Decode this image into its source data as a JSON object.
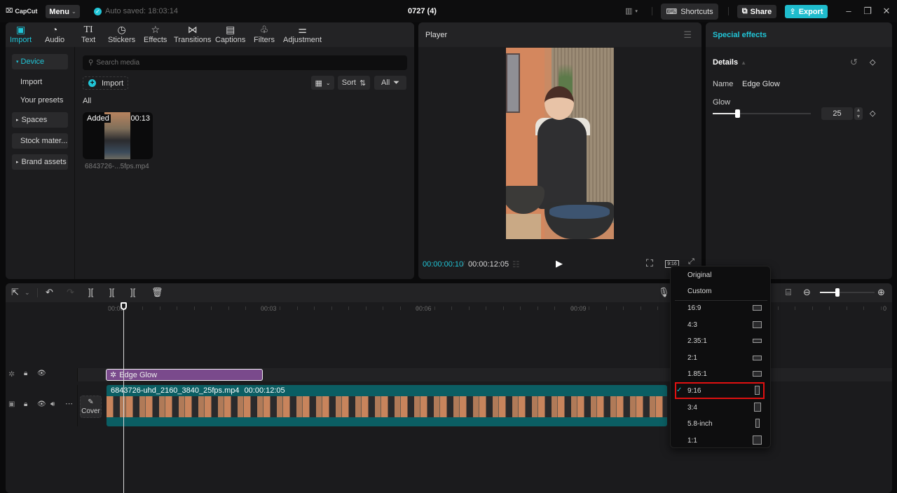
{
  "titlebar": {
    "app_name": "CapCut",
    "menu_label": "Menu",
    "autosave_text": "Auto saved: 18:03:14",
    "project_title": "0727 (4)",
    "shortcuts_label": "Shortcuts",
    "share_label": "Share",
    "export_label": "Export",
    "accent_color": "#21c5d7"
  },
  "media_tabs": [
    {
      "label": "Import",
      "icon": "import-icon",
      "active": true
    },
    {
      "label": "Audio",
      "icon": "audio-icon"
    },
    {
      "label": "Text",
      "icon": "text-icon"
    },
    {
      "label": "Stickers",
      "icon": "stickers-icon"
    },
    {
      "label": "Effects",
      "icon": "effects-icon"
    },
    {
      "label": "Transitions",
      "icon": "transitions-icon"
    },
    {
      "label": "Captions",
      "icon": "captions-icon"
    },
    {
      "label": "Filters",
      "icon": "filters-icon"
    },
    {
      "label": "Adjustment",
      "icon": "adjustment-icon"
    }
  ],
  "media_sidebar": {
    "items": [
      {
        "label": "Device",
        "expanded": true,
        "active": true
      },
      {
        "label": "Import"
      },
      {
        "label": "Your presets"
      },
      {
        "label": "Spaces",
        "collapsed": true
      },
      {
        "label": "Stock mater..."
      },
      {
        "label": "Brand assets",
        "collapsed": true
      }
    ]
  },
  "media": {
    "search_placeholder": "Search media",
    "import_label": "Import",
    "sort_label": "Sort",
    "filter_label": "All",
    "section_label": "All",
    "items": [
      {
        "badge": "Added",
        "duration": "00:13",
        "filename": "6843726-...5fps.mp4"
      }
    ]
  },
  "player": {
    "title": "Player",
    "current_time": "00:00:00:10",
    "total_time": "00:00:12:05",
    "ratio_label": "9:16"
  },
  "properties": {
    "header": "Special effects",
    "section": "Details",
    "name_label": "Name",
    "name_value": "Edge Glow",
    "glow_label": "Glow",
    "glow_value": "25",
    "glow_fraction": 0.25
  },
  "timeline": {
    "ruler_labels": [
      "00:00",
      "00:03",
      "00:06",
      "00:09",
      "0"
    ],
    "effect_clip_label": "Edge Glow",
    "video_clip_name": "6843726-uhd_2160_3840_25fps.mp4",
    "video_clip_duration": "00:00:12:05",
    "cover_label": "Cover",
    "zoom_fraction": 0.32
  },
  "ratio_dropdown": {
    "items": [
      {
        "label": "Original"
      },
      {
        "label": "Custom"
      },
      {
        "label": "16:9",
        "shape": "wide"
      },
      {
        "label": "4:3",
        "shape": "standard"
      },
      {
        "label": "2.35:1",
        "shape": "cinema"
      },
      {
        "label": "2:1",
        "shape": "wide2"
      },
      {
        "label": "1.85:1",
        "shape": "wide185"
      },
      {
        "label": "9:16",
        "shape": "tall",
        "selected": true
      },
      {
        "label": "3:4",
        "shape": "portrait"
      },
      {
        "label": "5.8-inch",
        "shape": "phone"
      },
      {
        "label": "1:1",
        "shape": "square"
      }
    ]
  }
}
